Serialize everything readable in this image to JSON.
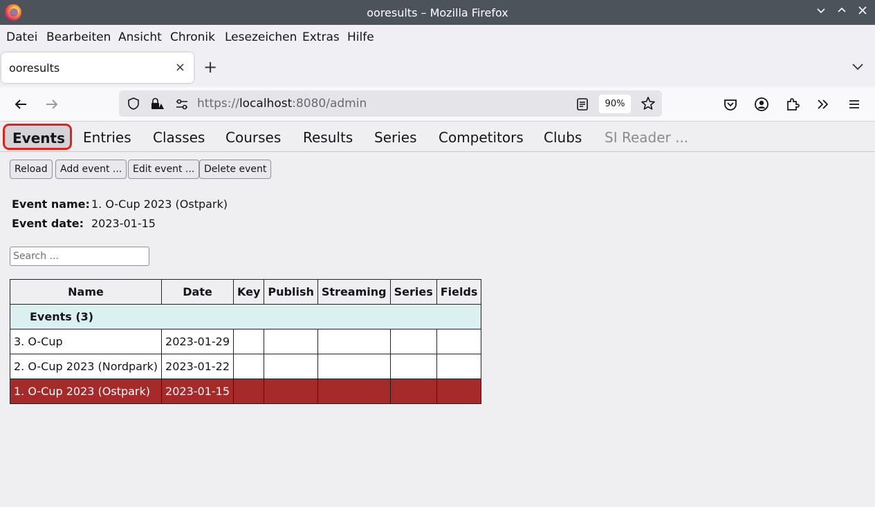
{
  "window": {
    "title": "ooresults – Mozilla Firefox",
    "controls": [
      "⌄",
      "⌃",
      "✕"
    ]
  },
  "menubar": [
    {
      "label": "Datei"
    },
    {
      "label": "Bearbeiten"
    },
    {
      "label": "Ansicht"
    },
    {
      "label": "Chronik"
    },
    {
      "label": "Lesezeichen"
    },
    {
      "label": "Extras"
    },
    {
      "label": "Hilfe"
    }
  ],
  "browser_tab": {
    "title": "ooresults",
    "close": "×",
    "new_tab": "+"
  },
  "urlbar": {
    "scheme": "https://",
    "host": "localhost",
    "rest": ":8080/admin",
    "zoom": "90%"
  },
  "app_tabs": [
    {
      "label": "Events",
      "active": true
    },
    {
      "label": "Entries"
    },
    {
      "label": "Classes"
    },
    {
      "label": "Courses"
    },
    {
      "label": "Results"
    },
    {
      "label": "Series"
    },
    {
      "label": "Competitors"
    },
    {
      "label": "Clubs"
    },
    {
      "label": "SI Reader ...",
      "disabled": true
    }
  ],
  "toolbar": {
    "reload": "Reload",
    "add": "Add event ...",
    "edit": "Edit event ...",
    "delete": "Delete event"
  },
  "event_info": {
    "name_label": "Event name:",
    "name_value": "1. O-Cup 2023 (Ostpark)",
    "date_label": "Event date:",
    "date_value": "2023-01-15"
  },
  "search": {
    "placeholder": "Search ..."
  },
  "table": {
    "headers": [
      "Name",
      "Date",
      "Key",
      "Publish",
      "Streaming",
      "Series",
      "Fields"
    ],
    "group_label": "Events  (3)",
    "rows": [
      {
        "name": "3. O-Cup",
        "date": "2023-01-29",
        "selected": false
      },
      {
        "name": "2. O-Cup 2023 (Nordpark)",
        "date": "2023-01-22",
        "selected": false
      },
      {
        "name": "1. O-Cup 2023 (Ostpark)",
        "date": "2023-01-15",
        "selected": true
      }
    ]
  },
  "colors": {
    "selected_row": "#a52a2a",
    "group_row": "#dbf0f1",
    "active_tab_outline": "#e5201b",
    "titlebar": "#4d535a"
  }
}
